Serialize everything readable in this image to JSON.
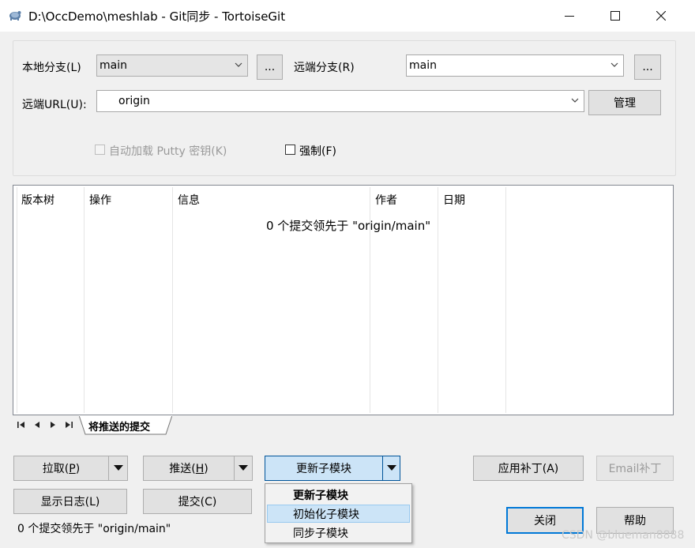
{
  "window": {
    "title": "D:\\OccDemo\\meshlab - Git同步 - TortoiseGit",
    "controls": [
      "minimize-icon",
      "maximize-icon",
      "close-icon"
    ]
  },
  "branches": {
    "local_label": "本地分支(L)",
    "local_value": "main",
    "local_more": "...",
    "remote_label": "远端分支(R)",
    "remote_value": "main",
    "remote_more": "...",
    "url_label": "远端URL(U):",
    "url_value": "origin",
    "manage_button": "管理"
  },
  "options": {
    "autoload_putty_label": "自动加载 Putty 密钥(K)",
    "autoload_putty_checked": false,
    "autoload_putty_enabled": false,
    "force_label": "强制(F)",
    "force_checked": false
  },
  "list": {
    "columns": [
      "版本树",
      "操作",
      "信息",
      "作者",
      "日期"
    ],
    "empty_message": "0 个提交领先于 \"origin/main\""
  },
  "tabs": {
    "active": "将推送的提交",
    "nav_icons": [
      "first-icon",
      "prev-icon",
      "next-icon",
      "last-icon"
    ]
  },
  "buttons": {
    "pull": "拉取(P)",
    "push": "推送(H)",
    "submodule": "更新子模块",
    "apply_patch": "应用补丁(A)",
    "email_patch": "Email补丁",
    "show_log": "显示日志(L)",
    "commit": "提交(C)",
    "close": "关闭",
    "help": "帮助"
  },
  "submodule_menu": {
    "items": [
      "更新子模块",
      "初始化子模块",
      "同步子模块"
    ],
    "default_item": "更新子模块",
    "highlighted_item": "初始化子模块"
  },
  "status": {
    "text": "0 个提交领先于 \"origin/main\""
  },
  "watermark": "CSDN @blueman8888",
  "colors": {
    "menu_highlight": "#cce4f7",
    "focused_button_border": "#0078d7",
    "dropdown_open_button": "#cce4f7"
  }
}
